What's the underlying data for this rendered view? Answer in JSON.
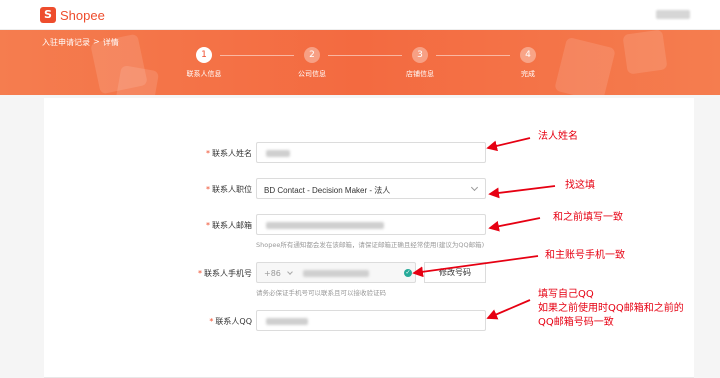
{
  "header": {
    "logo_text": "Shopee",
    "logo_icon": "shopee-bag-icon"
  },
  "breadcrumb": {
    "parent": "入驻申请记录",
    "sep": ">",
    "current": "详情"
  },
  "steps": [
    {
      "num": "1",
      "label": "联系人信息"
    },
    {
      "num": "2",
      "label": "公司信息"
    },
    {
      "num": "3",
      "label": "店铺信息"
    },
    {
      "num": "4",
      "label": "完成"
    }
  ],
  "form": {
    "required_mark": "*",
    "name_label": "联系人姓名",
    "position_label": "联系人职位",
    "position_value": "BD Contact - Decision Maker - 法人",
    "email_label": "联系人邮箱",
    "email_hint": "Shopee所有通知都会发在该邮箱，请保证邮箱正确且经常使用(建议为QQ邮箱)",
    "phone_label": "联系人手机号",
    "phone_prefix": "+86",
    "phone_btn": "修改号码",
    "phone_hint": "请务必保证手机号可以联系且可以接收验证码",
    "qq_label": "联系人QQ"
  },
  "annotations": {
    "a1": "法人姓名",
    "a2": "找这填",
    "a3": "和之前填写一致",
    "a4": "和主账号手机一致",
    "a5_l1": "填写自己QQ",
    "a5_l2": "如果之前使用时QQ邮箱和之前的",
    "a5_l3": "QQ邮箱号码一致"
  },
  "colors": {
    "brand": "#ee4d2d",
    "annotation": "#e60012",
    "verified": "#26aa99"
  }
}
